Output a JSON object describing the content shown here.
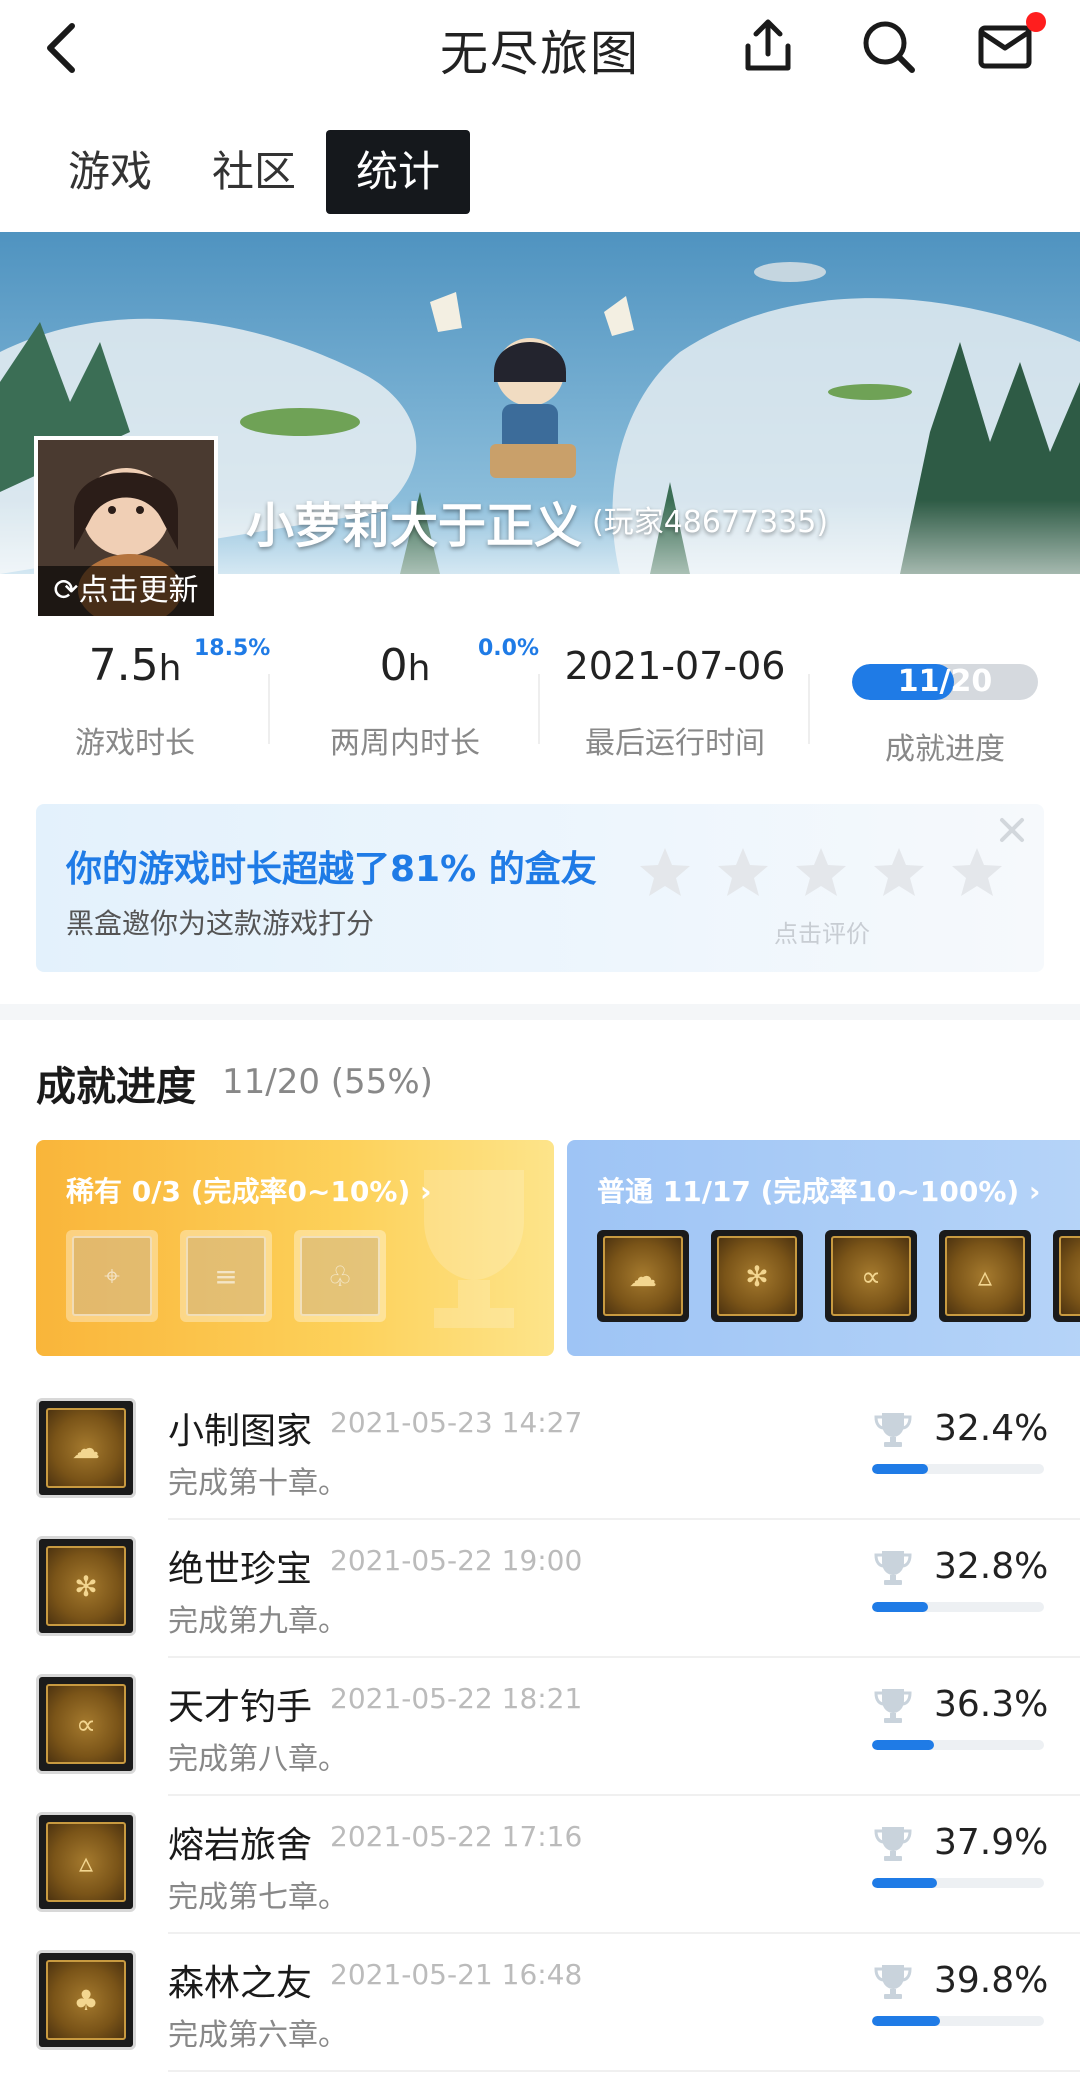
{
  "header": {
    "title": "无尽旅图"
  },
  "tabs": [
    {
      "label": "游戏"
    },
    {
      "label": "社区"
    },
    {
      "label": "统计"
    }
  ],
  "profile": {
    "username": "小萝莉大于正义",
    "player_id": "(玩家48677335)",
    "update_label": "点击更新"
  },
  "stats": {
    "playtime": {
      "value": "7.5",
      "unit": "h",
      "pct": "18.5%",
      "label": "游戏时长"
    },
    "two_week": {
      "value": "0",
      "unit": "h",
      "pct": "0.0%",
      "label": "两周内时长"
    },
    "last_run": {
      "value": "2021-07-06",
      "label": "最后运行时间"
    },
    "achievement": {
      "value": "11/20",
      "fraction": 0.55,
      "label": "成就进度"
    }
  },
  "rate_card": {
    "title": "你的游戏时长超越了81% 的盒友",
    "subtitle": "黑盒邀你为这款游戏打分",
    "hint": "点击评价",
    "stars": 5
  },
  "achievements": {
    "title": "成就进度",
    "summary": "11/20 (55%)",
    "rare": {
      "label": "稀有 0/3 (完成率0~10%) ›"
    },
    "normal": {
      "label": "普通 11/17 (完成率10~100%) ›"
    },
    "items": [
      {
        "name": "小制图家",
        "time": "2021-05-23 14:27",
        "desc": "完成第十章。",
        "pct": "32.4%",
        "rate": 0.324,
        "icon": "cloud-icon"
      },
      {
        "name": "绝世珍宝",
        "time": "2021-05-22 19:00",
        "desc": "完成第九章。",
        "pct": "32.8%",
        "rate": 0.328,
        "icon": "snowflake-icon"
      },
      {
        "name": "天才钓手",
        "time": "2021-05-22 18:21",
        "desc": "完成第八章。",
        "pct": "36.3%",
        "rate": 0.363,
        "icon": "fish-icon"
      },
      {
        "name": "熔岩旅舍",
        "time": "2021-05-22 17:16",
        "desc": "完成第七章。",
        "pct": "37.9%",
        "rate": 0.379,
        "icon": "campfire-icon"
      },
      {
        "name": "森林之友",
        "time": "2021-05-21 16:48",
        "desc": "完成第六章。",
        "pct": "39.8%",
        "rate": 0.398,
        "icon": "tree-icon"
      }
    ]
  },
  "colors": {
    "accent": "#1f7be6",
    "rare": "#fdc94a",
    "normal": "#a9cdf7"
  }
}
